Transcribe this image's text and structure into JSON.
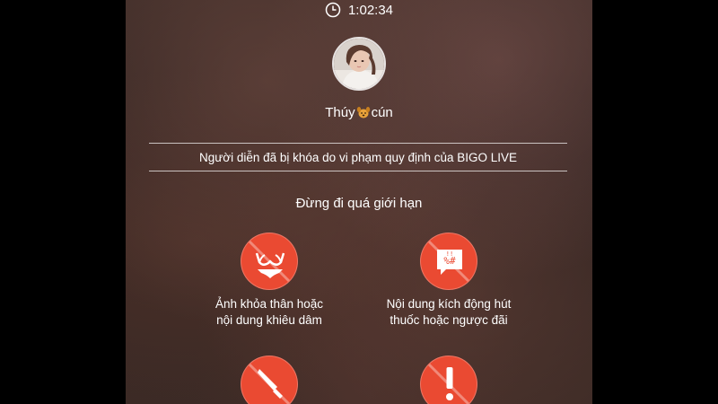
{
  "timer": {
    "icon": "clock-icon",
    "elapsed": "1:02:34"
  },
  "broadcaster": {
    "name_before": "Thúy",
    "emoji": "dog-emoji-icon",
    "name_after": "cún"
  },
  "ban_notice": "Người diễn đã bị khóa do vi phạm quy định của BIGO LIVE",
  "rules_title": "Đừng đi quá giới hạn",
  "rules": [
    {
      "icon": "lingerie-icon",
      "line1": "Ảnh khỏa thân hoặc",
      "line2": "nội dung khiêu dâm"
    },
    {
      "icon": "chat-symbols-icon",
      "line1": "Nội dung kích động hút",
      "line2": "thuốc hoặc ngược đãi"
    },
    {
      "icon": "knife-icon",
      "line1": "",
      "line2": ""
    },
    {
      "icon": "exclamation-icon",
      "line1": "",
      "line2": ""
    }
  ],
  "colors": {
    "accent": "#ea4a32",
    "text": "#ffffff"
  }
}
